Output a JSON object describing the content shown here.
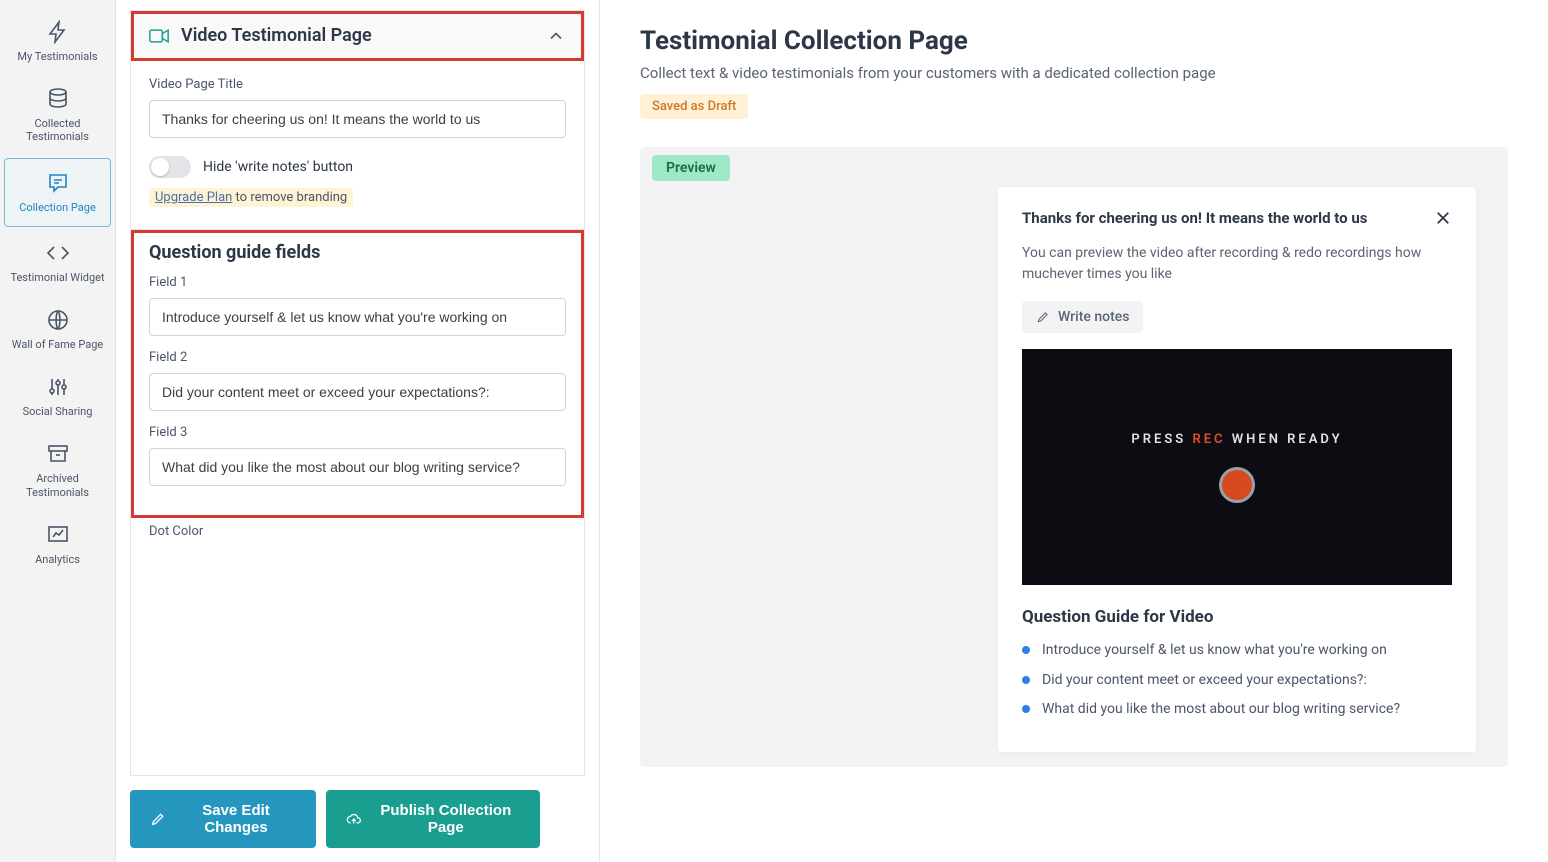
{
  "sidebar": {
    "items": [
      {
        "label": "My Testimonials"
      },
      {
        "label": "Collected Testimonials"
      },
      {
        "label": "Collection Page"
      },
      {
        "label": "Testimonial Widget"
      },
      {
        "label": "Wall of Fame Page"
      },
      {
        "label": "Social Sharing"
      },
      {
        "label": "Archived Testimonials"
      },
      {
        "label": "Analytics"
      }
    ]
  },
  "editor": {
    "panel_title": "Video Testimonial Page",
    "video_title_label": "Video Page Title",
    "video_title_value": "Thanks for cheering us on! It means the world to us",
    "hide_notes_label": "Hide 'write notes' button",
    "upgrade_link": "Upgrade Plan",
    "upgrade_rest": " to remove branding",
    "qg_title": "Question guide fields",
    "fields": [
      {
        "label": "Field 1",
        "value": "Introduce yourself & let us know what you're working on"
      },
      {
        "label": "Field 2",
        "value": "Did your content meet or exceed your expectations?:"
      },
      {
        "label": "Field 3",
        "value": "What did you like the most about our blog writing service?"
      }
    ],
    "dot_color_label": "Dot Color",
    "save_label": "Save Edit Changes",
    "publish_label": "Publish Collection Page"
  },
  "preview": {
    "title": "Testimonial Collection Page",
    "subtitle": "Collect text & video testimonials from your customers with a dedicated collection page",
    "draft_label": "Saved as Draft",
    "badge_label": "Preview",
    "card_title": "Thanks for cheering us on! It means the world to us",
    "card_desc": "You can preview the video after recording & redo recordings how muchever times you like",
    "write_notes_label": "Write notes",
    "video_text_pre": "PRESS ",
    "video_text_rec": "REC",
    "video_text_post": " WHEN READY",
    "qg_title": "Question Guide for Video",
    "qg_items": [
      "Introduce yourself & let us know what you're working on",
      "Did your content meet or exceed your expectations?:",
      "What did you like the most about our blog writing service?"
    ]
  }
}
